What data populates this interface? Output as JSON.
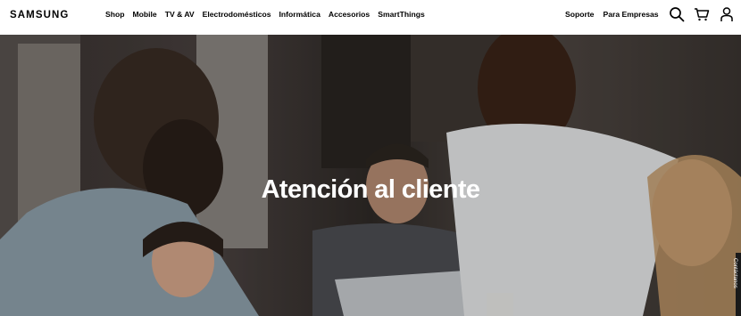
{
  "header": {
    "logo": "SAMSUNG",
    "nav": [
      {
        "label": "Shop"
      },
      {
        "label": "Mobile"
      },
      {
        "label": "TV & AV"
      },
      {
        "label": "Electrodomésticos"
      },
      {
        "label": "Informática"
      },
      {
        "label": "Accesorios"
      },
      {
        "label": "SmartThings"
      }
    ],
    "utility_nav": [
      {
        "label": "Soporte"
      },
      {
        "label": "Para Empresas"
      }
    ],
    "icons": [
      "search-icon",
      "cart-icon",
      "user-icon"
    ]
  },
  "hero": {
    "title": "Atención al cliente",
    "side_tab_label": "Contáctanos"
  }
}
